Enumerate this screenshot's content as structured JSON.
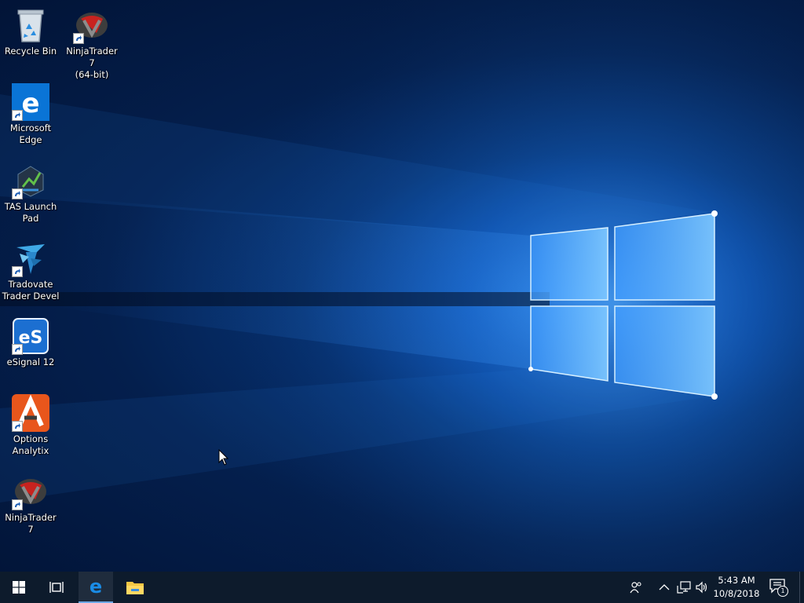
{
  "desktop": {
    "icons": [
      {
        "id": "recycle-bin",
        "label": "Recycle Bin",
        "icon": "recycle-bin-icon",
        "shortcut": false
      },
      {
        "id": "ninjatrader-64",
        "label": "NinjaTrader 7\n(64-bit)",
        "icon": "ninjatrader-icon",
        "shortcut": true
      },
      {
        "id": "edge",
        "label": "Microsoft\nEdge",
        "icon": "edge-icon",
        "shortcut": true
      },
      {
        "id": "tas",
        "label": "TAS Launch\nPad",
        "icon": "tas-icon",
        "shortcut": true
      },
      {
        "id": "tradovate",
        "label": "Tradovate\nTrader Devel",
        "icon": "tradovate-icon",
        "shortcut": true
      },
      {
        "id": "esignal",
        "label": "eSignal 12",
        "icon": "esignal-icon",
        "shortcut": true
      },
      {
        "id": "options-analytix",
        "label": "Options\nAnalytix",
        "icon": "options-analytix-icon",
        "shortcut": true
      },
      {
        "id": "ninjatrader",
        "label": "NinjaTrader 7",
        "icon": "ninjatrader-icon",
        "shortcut": true
      }
    ]
  },
  "taskbar": {
    "start": "windows-logo-icon",
    "task_view": "task-view-icon",
    "pinned": [
      "edge-icon",
      "file-explorer-icon"
    ],
    "tray": [
      "people-icon",
      "show-hidden-icons-chevron",
      "network-icon",
      "volume-icon"
    ],
    "clock": {
      "time": "5:43 AM",
      "date": "10/8/2018"
    },
    "notifications": {
      "icon": "action-center-icon",
      "count": "1"
    }
  },
  "colors": {
    "taskbar_bg": "#0d1b2c",
    "accent": "#6ca8e6",
    "edge_blue": "#0a74d6"
  }
}
